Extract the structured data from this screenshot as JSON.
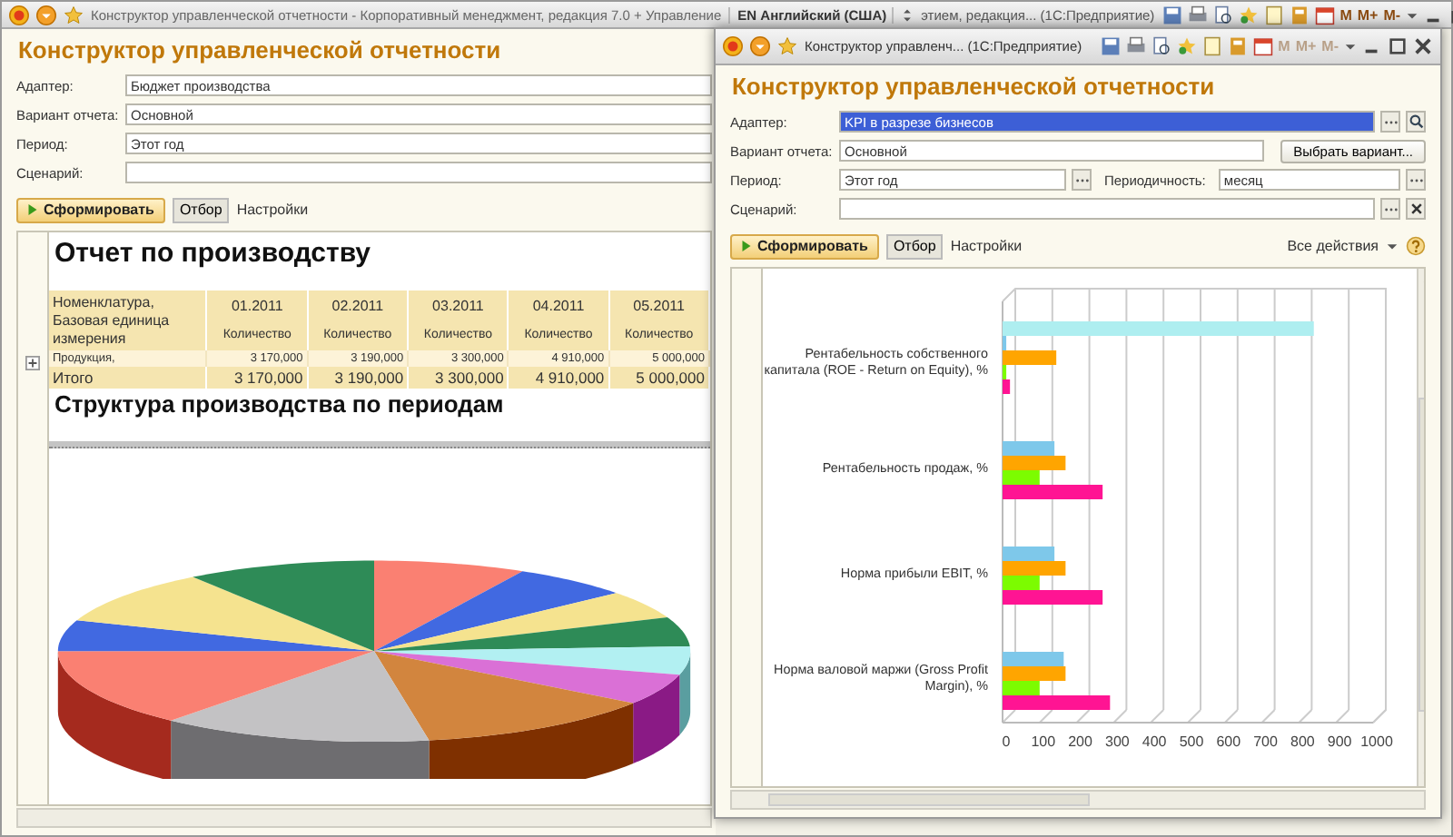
{
  "back_window": {
    "title": "Конструктор управленческой отчетности - Корпоративный менеджмент, редакция 7.0 + Управление",
    "language_indicator": "EN Английский (США)",
    "other_window_title": "этием, редакция... (1С:Предприятие)",
    "memory_buttons": [
      "M",
      "M+",
      "M-"
    ],
    "heading": "Конструктор управленческой отчетности",
    "fields": [
      {
        "label": "Адаптер:",
        "value": "Бюджет производства"
      },
      {
        "label": "Вариант отчета:",
        "value": "Основной"
      },
      {
        "label": "Период:",
        "value": "Этот год"
      },
      {
        "label": "Сценарий:"
      }
    ],
    "toolbar": {
      "generate_button": "Сформировать",
      "filter_button": "Отбор",
      "settings_link": "Настройки"
    },
    "report": {
      "title": "Отчет по производству",
      "table": {
        "first_column": "Номенклатура, Базовая единица измерения",
        "columns": [
          {
            "period": "01.2011",
            "measure": "Количество"
          },
          {
            "period": "02.2011",
            "measure": "Количество"
          },
          {
            "period": "03.2011",
            "measure": "Количество"
          },
          {
            "period": "04.2011",
            "measure": "Количество"
          },
          {
            "period": "05.2011",
            "measure": "Количество"
          }
        ],
        "rows": [
          {
            "kind": "group",
            "label": "Продукция,",
            "values": [
              "3 170,000",
              "3 190,000",
              "3 300,000",
              "4 910,000",
              "5 000,000"
            ]
          },
          {
            "kind": "total",
            "label": "Итого",
            "values": [
              "3 170,000",
              "3 190,000",
              "3 300,000",
              "4 910,000",
              "5 000,000"
            ]
          }
        ]
      },
      "chart_title": "Структура производства по периодам"
    }
  },
  "front_window": {
    "title": "Конструктор управленч... (1С:Предприятие)",
    "memory_buttons": [
      "M",
      "M+",
      "M-"
    ],
    "heading": "Конструктор управленческой отчетности",
    "fields": [
      {
        "label": "Адаптер:",
        "value": "KPI в разрезе бизнесов",
        "selected": true
      },
      {
        "label": "Вариант отчета:",
        "value": "Основной",
        "selected": false
      },
      {
        "label": "Период:",
        "value": "Этот год",
        "selected": false
      },
      {
        "label": "Сценарий:",
        "selected": false
      }
    ],
    "choose_variant_button": "Выбрать вариант...",
    "periodicity": {
      "label": "Периодичность:",
      "value": "месяц"
    },
    "toolbar": {
      "generate_button": "Сформировать",
      "filter_button": "Отбор",
      "settings_link": "Настройки",
      "all_actions": "Все действия"
    },
    "chart_data": {
      "type": "bar",
      "orientation": "horizontal",
      "categories": [
        "Рентабельность собственного капитала (ROE - Return on Equity), %",
        "Рентабельность продаж, %",
        "Норма прибыли EBIT, %",
        "Норма валовой маржи (Gross Profit Margin), %"
      ],
      "series": [
        {
          "color": "#aeeef0",
          "values": [
            840,
            null,
            null,
            null
          ]
        },
        {
          "color": "#7ec8ea",
          "values": [
            10,
            140,
            140,
            165
          ]
        },
        {
          "color": "#ffa500",
          "values": [
            145,
            170,
            170,
            170
          ]
        },
        {
          "color": "#7cfc00",
          "values": [
            10,
            100,
            100,
            100
          ]
        },
        {
          "color": "#ff1493",
          "values": [
            20,
            270,
            270,
            290
          ]
        }
      ],
      "xlim": [
        0,
        1000
      ],
      "xticks": [
        0,
        100,
        200,
        300,
        400,
        500,
        600,
        700,
        800,
        900,
        1000
      ]
    }
  }
}
